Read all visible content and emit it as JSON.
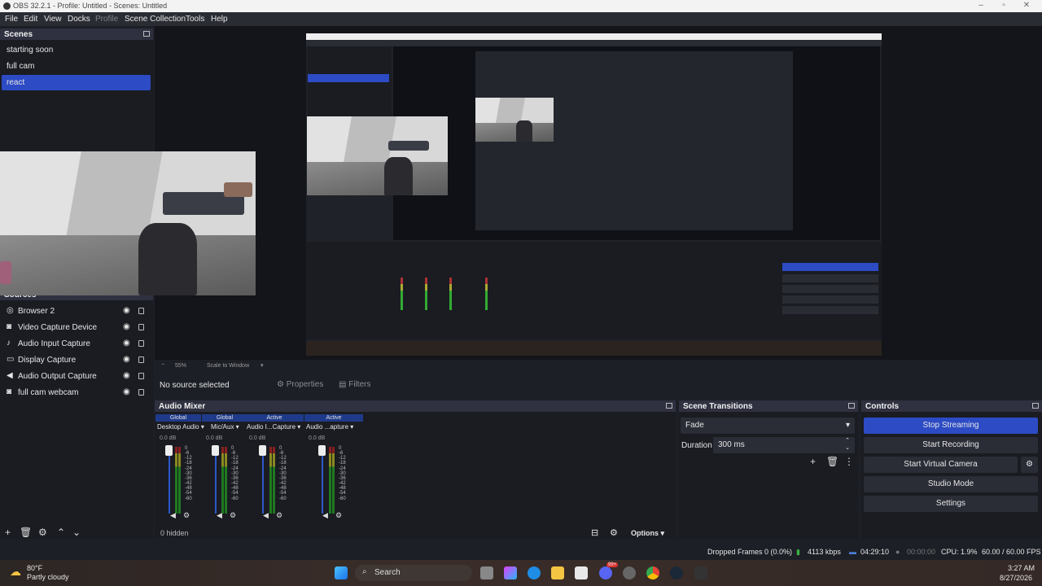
{
  "window": {
    "title": "OBS 32.2.1 - Profile: Untitled - Scenes: Untitled"
  },
  "menu": [
    "File",
    "Edit",
    "View",
    "Docks",
    "Profile",
    "Scene Collection",
    "Tools",
    "Help"
  ],
  "scenes": {
    "header": "Scenes",
    "items": [
      {
        "label": "starting soon",
        "active": false
      },
      {
        "label": "full cam",
        "active": false
      },
      {
        "label": "react",
        "active": true
      }
    ]
  },
  "sources": {
    "header": "Sources",
    "items": [
      {
        "label": "Browser 2",
        "icon": "globe-icon"
      },
      {
        "label": "Video Capture Device",
        "icon": "camera-icon"
      },
      {
        "label": "Audio Input Capture",
        "icon": "microphone-icon"
      },
      {
        "label": "Display Capture",
        "icon": "monitor-icon"
      },
      {
        "label": "Audio Output Capture",
        "icon": "speaker-icon"
      },
      {
        "label": "full cam webcam",
        "icon": "camera-icon"
      }
    ]
  },
  "preview_bar": {
    "zoom": "55%",
    "scale": "Scale to Window"
  },
  "context_bar": {
    "no_source": "No source selected",
    "properties": "Properties",
    "filters": "Filters"
  },
  "audio_mixer": {
    "header": "Audio Mixer",
    "channels": [
      {
        "badge": "Global",
        "name": "Desktop Audio",
        "db": "0.0 dB",
        "level": 0.0
      },
      {
        "badge": "Global",
        "name": "Mic/Aux",
        "db": "0.0 dB",
        "level": 0.0
      },
      {
        "badge": "Active",
        "name": "Audio I...Capture",
        "db": "0.0 dB",
        "level": 0.2
      },
      {
        "badge": "Active",
        "name": "Audio ...apture",
        "db": "0.0 dB",
        "level": 0.0
      }
    ],
    "ticks": [
      "0",
      "-6",
      "-12",
      "-18",
      "-24",
      "-30",
      "-36",
      "-42",
      "-48",
      "-54",
      "-60"
    ],
    "hidden": "0 hidden",
    "options": "Options"
  },
  "transitions": {
    "header": "Scene Transitions",
    "selected": "Fade",
    "duration_label": "Duration",
    "duration_value": "300 ms"
  },
  "controls": {
    "header": "Controls",
    "stop_streaming": "Stop Streaming",
    "start_recording": "Start Recording",
    "start_virtual_camera": "Start Virtual Camera",
    "studio_mode": "Studio Mode",
    "settings": "Settings"
  },
  "status": {
    "dropped_frames": "Dropped Frames 0 (0.0%)",
    "bitrate": "4113 kbps",
    "stream_time": "04:29:10",
    "rec_time": "00:00:00",
    "cpu": "CPU: 1.9%",
    "fps": "60.00 / 60.00 FPS"
  },
  "taskbar": {
    "weather_temp": "80°F",
    "weather_desc": "Partly cloudy",
    "search": "Search",
    "time": "3:27 AM",
    "date": "8/27/2026",
    "discord_badge": "99+"
  },
  "colors": {
    "accent": "#2c4bc4",
    "panel": "#1a1c22",
    "header": "#2f3140"
  }
}
